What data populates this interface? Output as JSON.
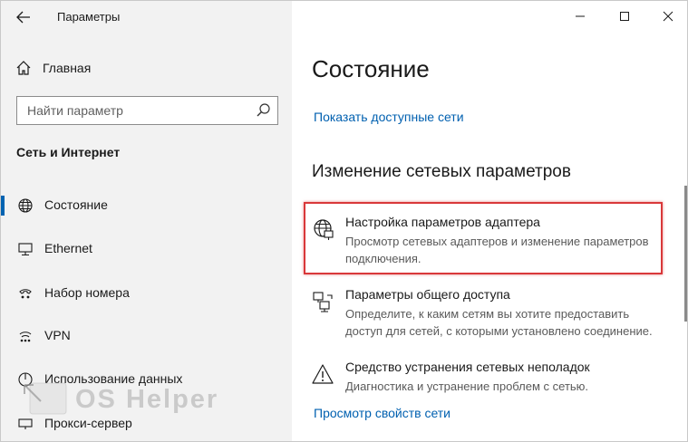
{
  "window": {
    "title": "Параметры"
  },
  "sidebar": {
    "home_label": "Главная",
    "search_placeholder": "Найти параметр",
    "section_title": "Сеть и Интернет",
    "items": [
      {
        "label": "Состояние",
        "icon": "globe-icon",
        "active": true
      },
      {
        "label": "Ethernet",
        "icon": "monitor-icon",
        "active": false
      },
      {
        "label": "Набор номера",
        "icon": "dialup-icon",
        "active": false
      },
      {
        "label": "VPN",
        "icon": "vpn-icon",
        "active": false
      },
      {
        "label": "Использование данных",
        "icon": "data-usage-icon",
        "active": false
      },
      {
        "label": "Прокси-сервер",
        "icon": "proxy-icon",
        "active": false
      }
    ]
  },
  "main": {
    "title": "Состояние",
    "show_networks_link": "Показать доступные сети",
    "change_heading": "Изменение сетевых параметров",
    "settings": [
      {
        "title": "Настройка параметров адаптера",
        "desc": "Просмотр сетевых адаптеров и изменение параметров подключения.",
        "icon": "adapter-globe-icon"
      },
      {
        "title": "Параметры общего доступа",
        "desc": "Определите, к каким сетям вы хотите предоставить доступ для сетей, с которыми установлено соединение.",
        "icon": "sharing-icon"
      },
      {
        "title": "Средство устранения сетевых неполадок",
        "desc": "Диагностика и устранение проблем с сетью.",
        "icon": "warning-icon"
      }
    ],
    "properties_link": "Просмотр свойств сети"
  },
  "watermark": {
    "text": "OS Helper"
  },
  "colors": {
    "accent": "#0063b1",
    "link": "#0060b0",
    "highlight_border": "#d9383a",
    "sidebar_bg": "#f2f2f2"
  }
}
